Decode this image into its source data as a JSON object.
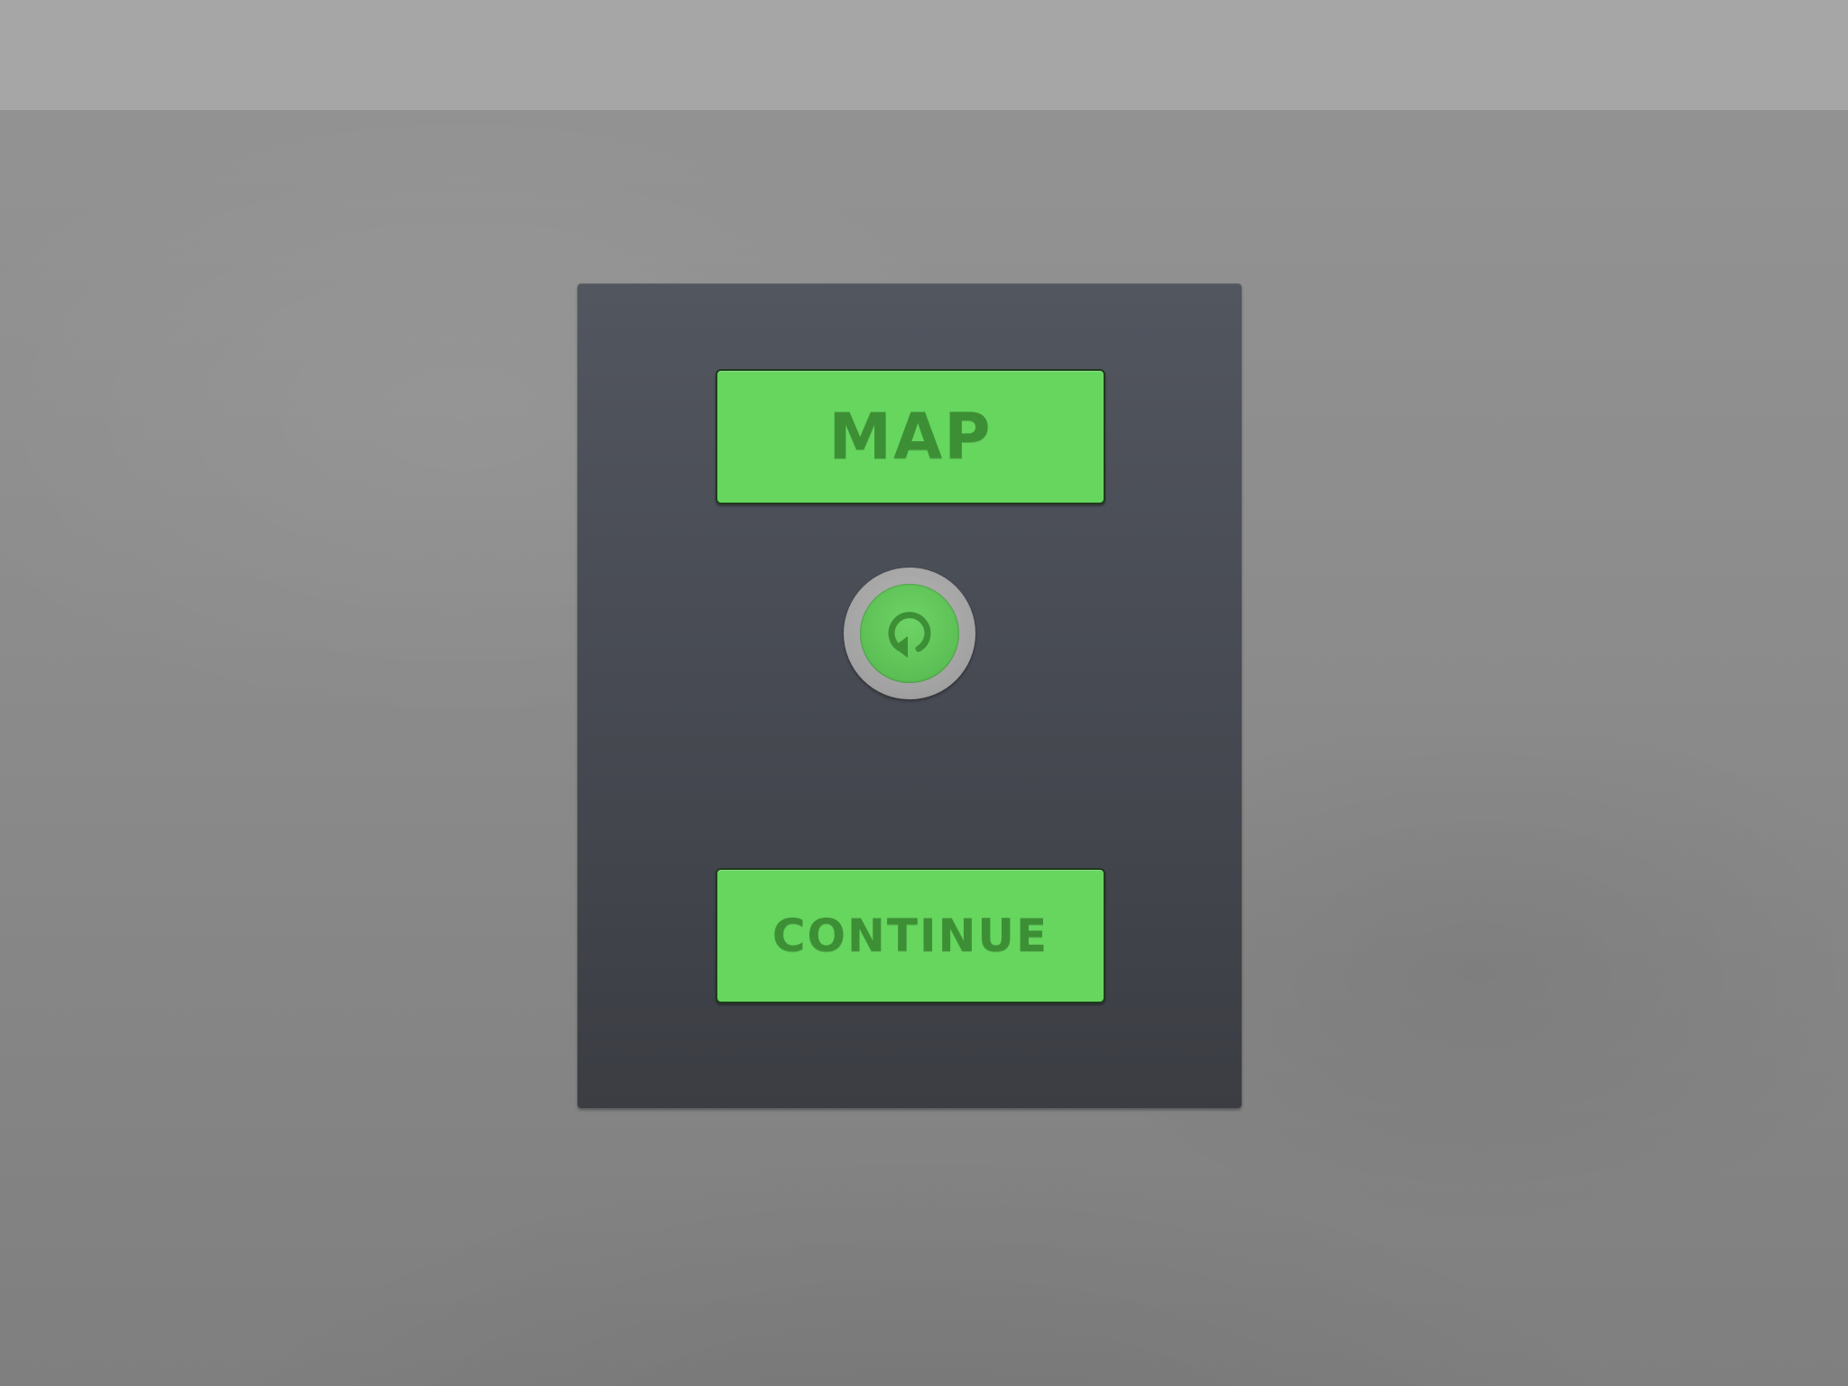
{
  "menu": {
    "map_label": "MAP",
    "continue_label": "CONTINUE",
    "restart_icon": "restart-icon"
  },
  "colors": {
    "button_fill": "#66d65e",
    "button_text": "#3d8f35",
    "panel": "#474a52",
    "background": "#8c8c8c"
  }
}
